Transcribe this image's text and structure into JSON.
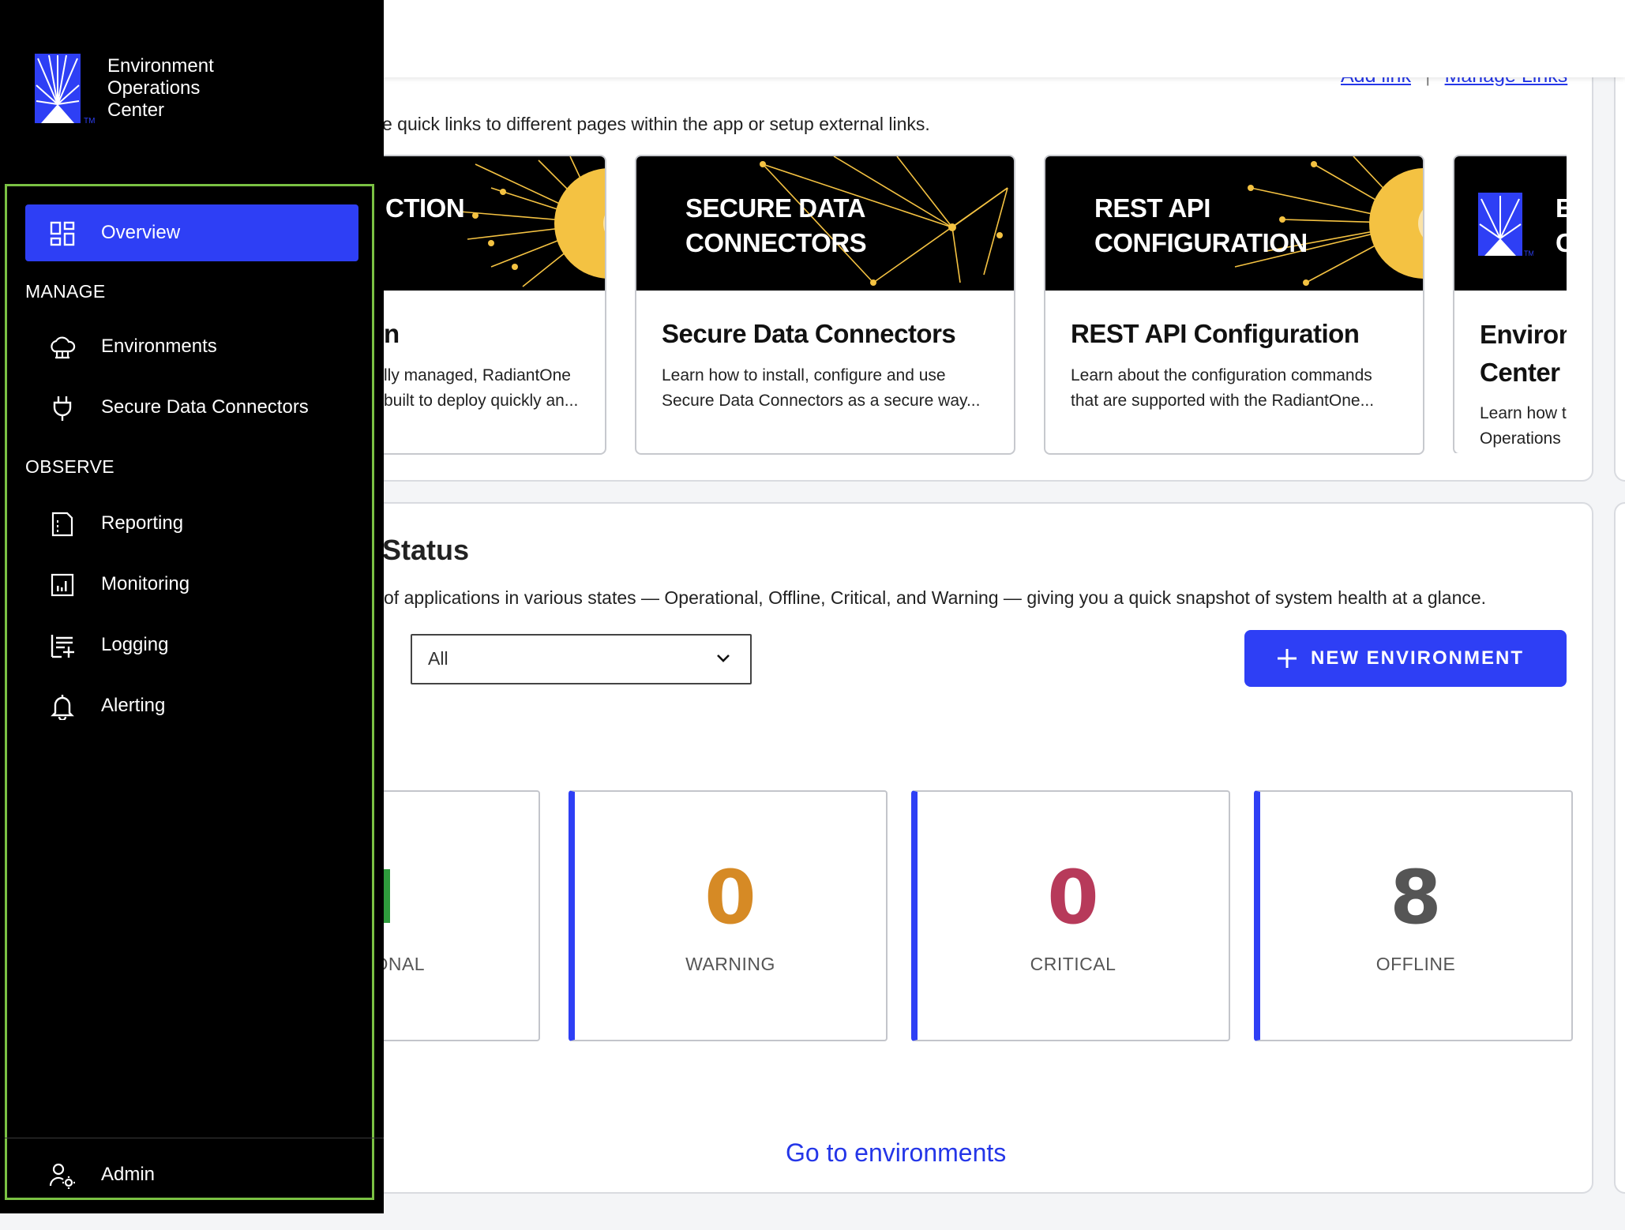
{
  "brand": {
    "line1": "Environment",
    "line2": "Operations",
    "line3": "Center",
    "tm": "TM"
  },
  "sidebar": {
    "items": [
      {
        "label": "Overview",
        "icon": "dashboard-icon",
        "active": true
      },
      {
        "label": "Environments",
        "icon": "cloud-icon"
      },
      {
        "label": "Secure Data Connectors",
        "icon": "plug-icon"
      },
      {
        "label": "Reporting",
        "icon": "report-icon"
      },
      {
        "label": "Monitoring",
        "icon": "chart-icon"
      },
      {
        "label": "Logging",
        "icon": "log-icon"
      },
      {
        "label": "Alerting",
        "icon": "bell-icon"
      }
    ],
    "sections": {
      "manage": "MANAGE",
      "observe": "OBSERVE"
    },
    "admin": {
      "label": "Admin",
      "icon": "user-gear-icon"
    }
  },
  "quicklinks": {
    "add_link": "Add link",
    "separator": "|",
    "manage_links": "Manage Links",
    "description": "e quick links to different pages within the app or setup external links.",
    "cards": [
      {
        "banner": "CTION",
        "title": "n",
        "desc_line1": "lly managed, RadiantOne",
        "desc_line2": "built to deploy quickly an..."
      },
      {
        "banner_line1": "SECURE DATA",
        "banner_line2": "CONNECTORS",
        "title": "Secure Data Connectors",
        "desc_line1": "Learn how to install, configure and use",
        "desc_line2": "Secure Data Connectors as a secure way..."
      },
      {
        "banner_line1": "REST API",
        "banner_line2": "CONFIGURATION",
        "title": "REST API Configuration",
        "desc_line1": "Learn about the configuration commands",
        "desc_line2": "that are supported with the RadiantOne..."
      },
      {
        "banner_line1": "E",
        "banner_line2": "C",
        "title_line1": "Environ",
        "title_line2": "Center",
        "desc_line1": "Learn how t",
        "desc_line2": "Operations"
      }
    ]
  },
  "status": {
    "title": "Status",
    "description": "of applications in various states — Operational, Offline, Critical, and Warning — giving you a quick snapshot of system health at a glance.",
    "filter_value": "All",
    "new_env_label": "NEW ENVIRONMENT",
    "cards": [
      {
        "value": "",
        "label": "TIONAL",
        "color": "#2e9c3c"
      },
      {
        "value": "0",
        "label": "WARNING",
        "color": "#d68a25"
      },
      {
        "value": "0",
        "label": "CRITICAL",
        "color": "#b73a5a"
      },
      {
        "value": "8",
        "label": "OFFLINE",
        "color": "#555555"
      }
    ],
    "go_to": "Go to environments"
  },
  "colors": {
    "accent": "#2e3ff5",
    "sidebar_bg": "#000000",
    "highlight_frame": "#7ac143",
    "sun": "#f4c242"
  }
}
